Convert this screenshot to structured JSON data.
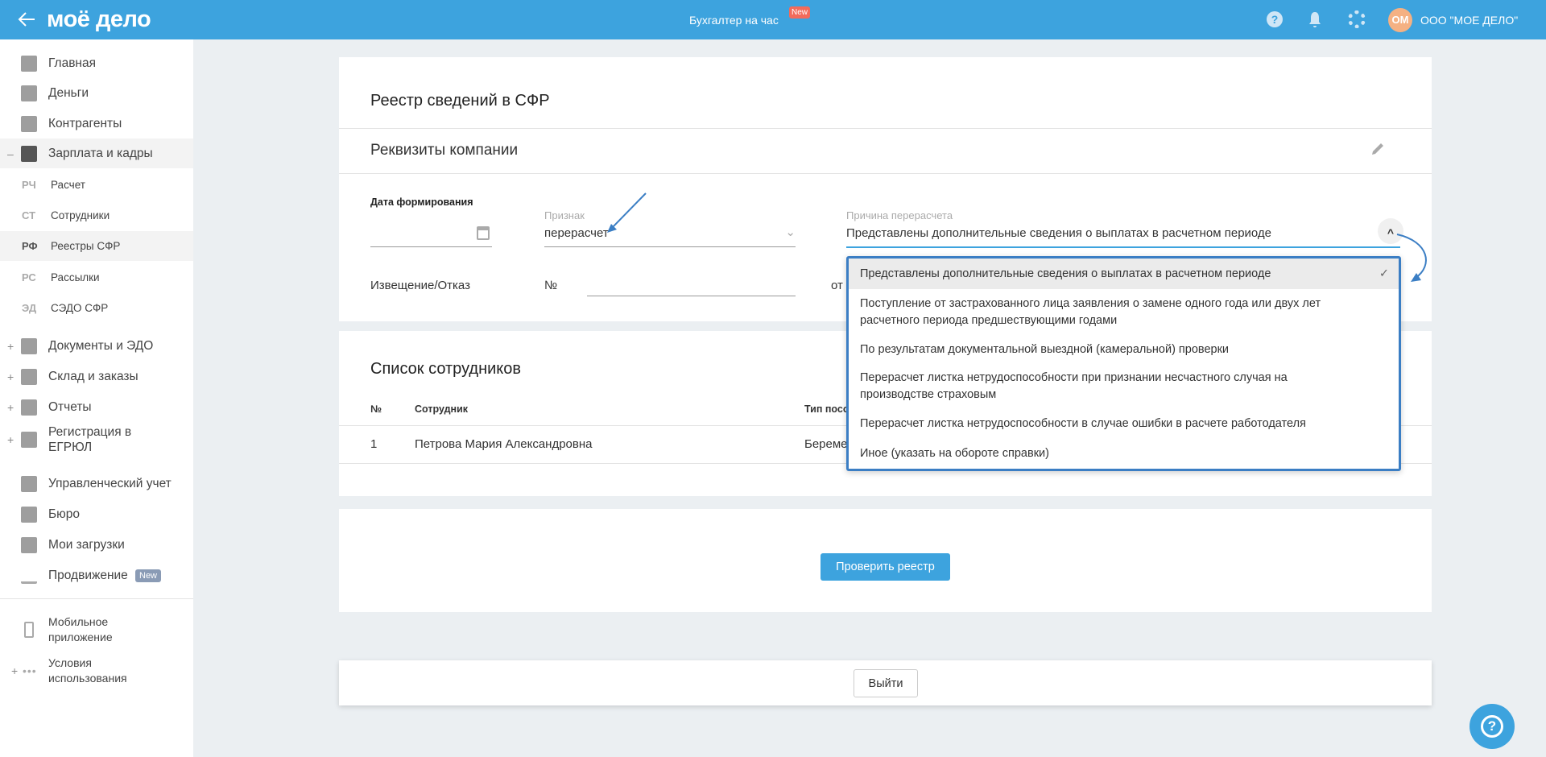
{
  "header": {
    "logo": "моё дело",
    "center_link": "Бухгалтер на час",
    "center_badge": "New",
    "avatar_initials": "ОМ",
    "company": "ООО \"МОЕ ДЕЛО\"",
    "accent": "#3da3de",
    "badge_color": "#f26b5b",
    "avatar_color": "#f5b183"
  },
  "sidebar": {
    "items": [
      {
        "label": "Главная",
        "icon": "home-icon"
      },
      {
        "label": "Деньги",
        "icon": "money-icon"
      },
      {
        "label": "Контрагенты",
        "icon": "contractor-icon"
      },
      {
        "label": "Зарплата и кадры",
        "icon": "wallet-icon",
        "expander": "–"
      },
      {
        "label": "Документы и ЭДО",
        "icon": "folder-icon",
        "expander": "+"
      },
      {
        "label": "Склад и заказы",
        "icon": "warehouse-icon",
        "expander": "+"
      },
      {
        "label": "Отчеты",
        "icon": "report-icon",
        "expander": "+"
      },
      {
        "label": "Регистрация в ЕГРЮЛ",
        "icon": "registration-icon",
        "expander": "+"
      },
      {
        "label": "Управленческий учет",
        "icon": "management-icon"
      },
      {
        "label": "Бюро",
        "icon": "briefcase-icon"
      },
      {
        "label": "Мои загрузки",
        "icon": "folder-icon"
      },
      {
        "label": "Продвижение",
        "icon": "chart-icon",
        "badge": "New"
      }
    ],
    "subitems": [
      {
        "code": "РЧ",
        "label": "Расчет"
      },
      {
        "code": "СТ",
        "label": "Сотрудники"
      },
      {
        "code": "РФ",
        "label": "Реестры СФР"
      },
      {
        "code": "РС",
        "label": "Рассылки"
      },
      {
        "code": "ЭД",
        "label": "СЭДО СФР"
      }
    ],
    "bottom": [
      {
        "label": "Мобильное приложение"
      },
      {
        "label": "Условия использования",
        "expander": "+"
      }
    ]
  },
  "page": {
    "title": "Реестр сведений в СФР",
    "requisites": "Реквизиты компании",
    "date_label": "Дата формирования",
    "date_value": "",
    "sign_label": "Признак",
    "sign_value": "перерасчет",
    "reason_label": "Причина перерасчета",
    "reason_value": "Представлены дополнительные сведения о выплатах в расчетном периоде",
    "notice_label": "Извещение/Отказ",
    "number_label": "№",
    "from_label": "от"
  },
  "dropdown": {
    "options": [
      "Представлены дополнительные сведения о выплатах в расчетном периоде",
      "Поступление от застрахованного лица заявления о замене одного года или двух лет расчетного периода предшествующими годами",
      "По результатам документальной выездной (камеральной) проверки",
      "Перерасчет листка нетрудоспособности при признании несчастного случая на производстве страховым",
      "Перерасчет листка нетрудоспособности в случае ошибки в расчете работодателя",
      "Иное (указать на обороте справки)"
    ],
    "selected_index": 0
  },
  "employees": {
    "title": "Список сотрудников",
    "columns": [
      "№",
      "Сотрудник",
      "Тип посо"
    ],
    "rows": [
      [
        "1",
        "Петрова Мария Александровна",
        "Береме"
      ]
    ]
  },
  "actions": {
    "check": "Проверить реестр",
    "exit": "Выйти"
  }
}
